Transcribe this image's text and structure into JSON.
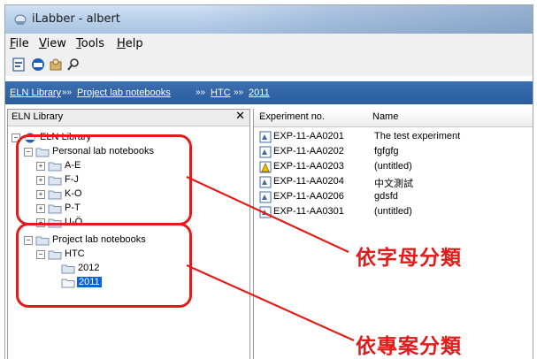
{
  "window": {
    "title": "iLabber - albert"
  },
  "menu": [
    {
      "label": "File"
    },
    {
      "label": "View"
    },
    {
      "label": "Tools"
    },
    {
      "label": "Help"
    }
  ],
  "toolbar": {
    "icons": [
      "document-icon",
      "library-icon",
      "user-icon",
      "search-icon"
    ]
  },
  "breadcrumb": {
    "items": [
      "ELN Library",
      "Project lab notebooks",
      "HTC",
      "2011"
    ],
    "separator": "»»"
  },
  "left_pane": {
    "title": "ELN Library",
    "close_label": "✕",
    "tree": {
      "root": "ELN Library",
      "personal": "Personal lab notebooks",
      "personal_children": [
        "A-E",
        "F-J",
        "K-O",
        "P-T",
        "U-Ö"
      ],
      "project": "Project lab notebooks",
      "project_child": "HTC",
      "years": [
        "2012",
        "2011"
      ],
      "selected": "2011"
    }
  },
  "table": {
    "columns": [
      "Experiment no.",
      "Name"
    ],
    "rows": [
      {
        "exp": "EXP-11-AA0201",
        "name": "The test experiment",
        "icon": "doc-icon"
      },
      {
        "exp": "EXP-11-AA0202",
        "name": "fgfgfg",
        "icon": "doc-icon"
      },
      {
        "exp": "EXP-11-AA0203",
        "name": "(untitled)",
        "icon": "warning-doc-icon"
      },
      {
        "exp": "EXP-11-AA0204",
        "name": "中文測試",
        "icon": "doc-icon"
      },
      {
        "exp": "EXP-11-AA0206",
        "name": "gdsfd",
        "icon": "doc-icon"
      },
      {
        "exp": "EXP-11-AA0301",
        "name": "(untitled)",
        "icon": "doc-icon"
      }
    ]
  },
  "annotations": {
    "by_letter": "依字母分類",
    "by_project": "依專案分類",
    "color": "#e21b1b"
  }
}
